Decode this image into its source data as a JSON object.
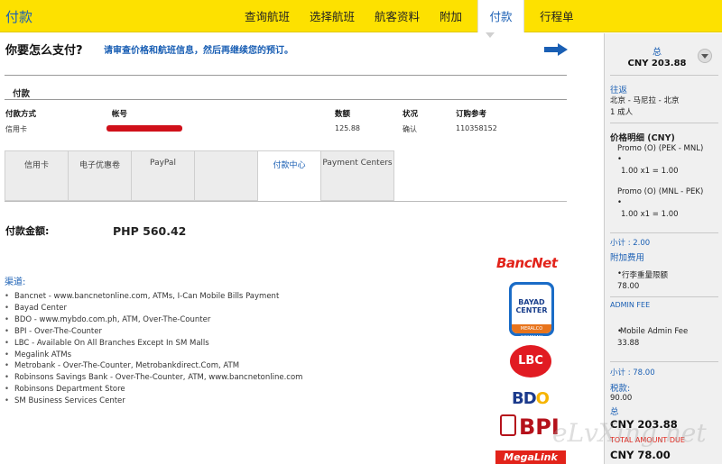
{
  "header": {
    "brand": "付款",
    "tabs": [
      {
        "label": "查询航班"
      },
      {
        "label": "选择航班"
      },
      {
        "label": "航客资料"
      },
      {
        "label": "附加"
      },
      {
        "label": "付款"
      },
      {
        "label": "行程单"
      }
    ],
    "active_tab": "付款"
  },
  "main": {
    "question": "你要怎么支付?",
    "hint": "请审查价格和航班信息，然后再继续您的预订。",
    "section_title": "付款",
    "table": {
      "headers": [
        "付款方式",
        "帐号",
        "数额",
        "状况",
        "订购参考"
      ],
      "row": [
        "信用卡",
        "",
        "125.88",
        "确认",
        "110358152"
      ]
    },
    "payment_tabs": [
      {
        "label": "信用卡"
      },
      {
        "label": "电子优惠卷"
      },
      {
        "label": "PayPal"
      },
      {
        "label": ""
      },
      {
        "label": "付款中心"
      },
      {
        "label": "Payment Centers"
      }
    ],
    "amount_label": "付款金额:",
    "amount_value": "PHP 560.42",
    "channels_title": "渠道:",
    "channels": [
      "Bancnet - www.bancnetonline.com, ATMs, I-Can Mobile Bills Payment",
      "Bayad Center",
      "BDO - www.mybdo.com.ph, ATM, Over-The-Counter",
      "BPI - Over-The-Counter",
      "LBC - Available On All Branches Except In SM Malls",
      "Megalink ATMs",
      "Metrobank - Over-The-Counter, Metrobankdirect.Com, ATM",
      "Robinsons Savings Bank - Over-The-Counter, ATM, www.bancnetonline.com",
      "Robinsons Department Store",
      "SM Business Services Center"
    ],
    "logos": {
      "bancnet": "BancNet",
      "bayad_top": "BAYAD",
      "bayad_mid": "CENTER",
      "bayad_sub": "MERALCO COMPANY",
      "lbc": "LBC",
      "bdo_a": "BD",
      "bdo_b": "O",
      "bpi": "BPI",
      "megalink": "MegaLink"
    }
  },
  "sidebar": {
    "total_label": "总",
    "total": "CNY 203.88",
    "trip_type": "往返",
    "route": "北京 - 马尼拉 - 北京",
    "pax": "1 成人",
    "price_detail_label": "价格明细 (CNY)",
    "fare1": "Promo (O) (PEK - MNL)",
    "fare1_calc": "1.00 x1 = 1.00",
    "fare2": "Promo (O) (MNL - PEK)",
    "fare2_calc": "1.00 x1 = 1.00",
    "subtotal1": "小计 : 2.00",
    "addon_label": "附加费用",
    "addon1": "行李重量限额",
    "addon1_amt": "78.00",
    "admin_label": "ADMIN FEE",
    "admin1": "Mobile Admin Fee",
    "admin1_amt": "33.88",
    "subtotal2": "小计 : 78.00",
    "tax_label": "税款:",
    "tax": "90.00",
    "total2_label": "总",
    "total2": "CNY 203.88",
    "due_label": "TOTAL AMOUNT DUE",
    "due": "CNY 78.00"
  },
  "watermark": "eLvXing.net",
  "colors": {
    "header_yellow": "#fde100",
    "link_blue": "#1a5fb4",
    "accent_red": "#e2231a"
  }
}
